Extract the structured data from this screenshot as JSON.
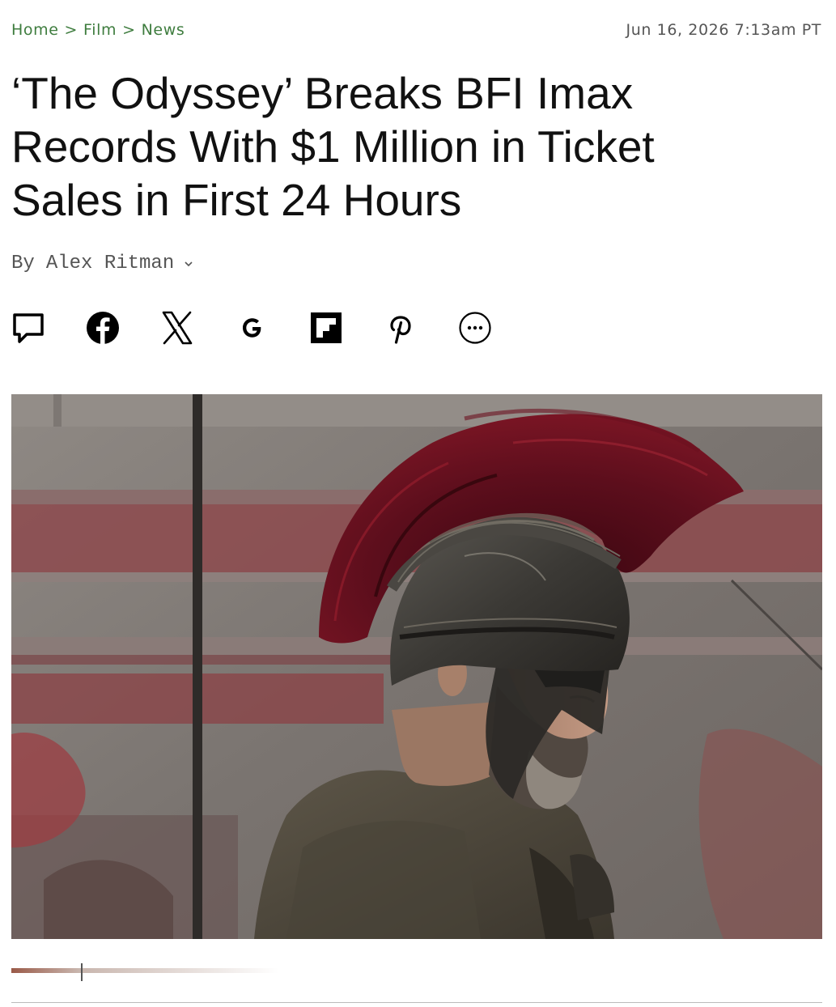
{
  "breadcrumb": {
    "items": [
      "Home",
      "Film",
      "News"
    ],
    "separator": ">"
  },
  "timestamp": "Jun 16, 2026 7:13am PT",
  "article": {
    "headline": "‘The Odyssey’ Breaks BFI Imax Records With $1 Million in Ticket Sales in First 24 Hours",
    "byline_prefix": "By",
    "author": "Alex Ritman"
  },
  "share_buttons": [
    {
      "icon": "comment-icon"
    },
    {
      "icon": "facebook-icon"
    },
    {
      "icon": "x-icon"
    },
    {
      "icon": "google-icon"
    },
    {
      "icon": "flipboard-icon"
    },
    {
      "icon": "pinterest-icon"
    },
    {
      "icon": "more-icon"
    }
  ],
  "colors": {
    "breadcrumb": "#3f7d3f",
    "text": "#111111",
    "muted": "#555555"
  }
}
